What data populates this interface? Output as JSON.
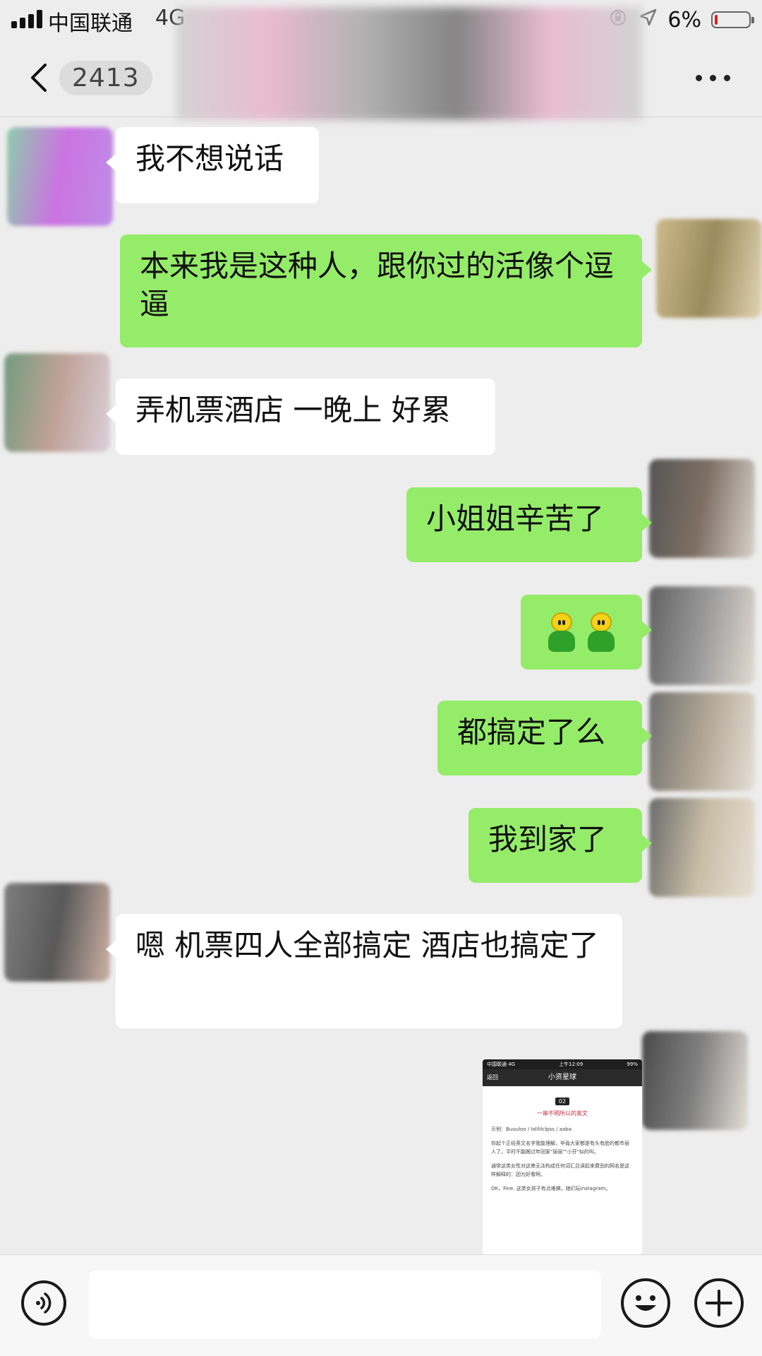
{
  "status_bar": {
    "carrier": "中国联通",
    "network": "4G",
    "battery_percent_label": "6%",
    "battery_level": 0.06
  },
  "nav": {
    "title": "2413",
    "back_icon": "chevron-left-icon",
    "more_icon": "more-dots-icon"
  },
  "messages": [
    {
      "side": "in",
      "text": "我不想说话"
    },
    {
      "side": "out",
      "text": "本来我是这种人，跟你过的活像个逗逼"
    },
    {
      "side": "in",
      "text": "弄机票酒店 一晚上 好累"
    },
    {
      "side": "out",
      "text": "小姐姐辛苦了"
    },
    {
      "side": "out",
      "type": "emoji",
      "emoji": "bot-emoji"
    },
    {
      "side": "out",
      "text": "都搞定了么"
    },
    {
      "side": "out",
      "text": "我到家了"
    },
    {
      "side": "in",
      "text": "嗯 机票四人全部搞定 酒店也搞定了"
    }
  ],
  "image_message": {
    "status_left": "中国联通 4G",
    "status_center": "上午12:09",
    "status_right": "99%",
    "back_label": "返回",
    "title": "小资星球",
    "section_number": "02",
    "heading": "一串不明所以的英文",
    "paragraphs": [
      "示例：Buuuloo / lolililclpss / aaba",
      "你起个正经英文名字我能理解，毕竟大家都是有头有脸的都市丽人了，平时不能跟过年回家\"丽丽\"\"小芬\"似的叫。",
      "通常这类女性对这串无法构成任何词汇且读起来费劲的网名是这样解释的：因为好看啊。",
      "OK，Fine. 这类女孩子有点难搞，她们玩instagram。"
    ]
  },
  "input_bar": {
    "voice_icon": "voice-icon",
    "emoji_icon": "smiley-icon",
    "plus_icon": "plus-icon",
    "value": ""
  },
  "colors": {
    "background": "#ededed",
    "incoming_bubble": "#ffffff",
    "outgoing_bubble": "#95ec69",
    "battery_low": "#e02020"
  }
}
